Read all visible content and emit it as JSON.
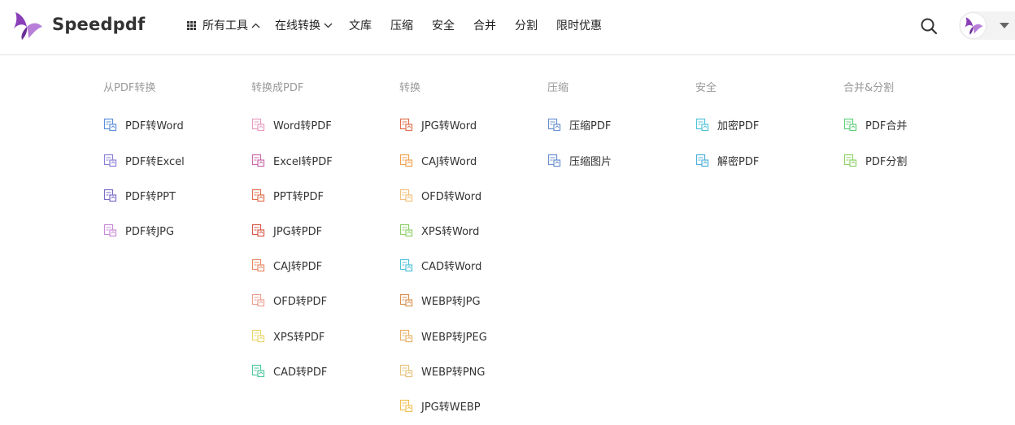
{
  "brand": {
    "name": "Speedpdf",
    "accent": "#9b4fc9"
  },
  "nav": [
    {
      "label": "所有工具",
      "icon": "grid-icon",
      "caret": "chevron-up-icon"
    },
    {
      "label": "在线转换",
      "caret": "chevron-down-icon"
    },
    {
      "label": "文库"
    },
    {
      "label": "压缩"
    },
    {
      "label": "安全"
    },
    {
      "label": "合并"
    },
    {
      "label": "分割"
    },
    {
      "label": "限时优惠"
    }
  ],
  "header_right": {
    "search_icon": "search-icon",
    "avatar_icon": "butterfly-avatar-icon",
    "menu_caret": "caret-down-icon"
  },
  "menu": [
    {
      "title": "从PDF转换",
      "items": [
        {
          "label": "PDF转Word",
          "color": "#5b8fd9"
        },
        {
          "label": "PDF转Excel",
          "color": "#8a7fd6"
        },
        {
          "label": "PDF转PPT",
          "color": "#7a6cc9"
        },
        {
          "label": "PDF转JPG",
          "color": "#c98bd8"
        }
      ]
    },
    {
      "title": "转换成PDF",
      "items": [
        {
          "label": "Word转PDF",
          "color": "#e79bc0"
        },
        {
          "label": "Excel转PDF",
          "color": "#c66aa8"
        },
        {
          "label": "PPT转PDF",
          "color": "#e0704f"
        },
        {
          "label": "JPG转PDF",
          "color": "#d85a4a"
        },
        {
          "label": "CAJ转PDF",
          "color": "#e88a66"
        },
        {
          "label": "OFD转PDF",
          "color": "#eda092"
        },
        {
          "label": "XPS转PDF",
          "color": "#e9d66a"
        },
        {
          "label": "CAD转PDF",
          "color": "#4fc9a0"
        }
      ]
    },
    {
      "title": "转换",
      "items": [
        {
          "label": "JPG转Word",
          "color": "#e0704f"
        },
        {
          "label": "CAJ转Word",
          "color": "#f0a24f"
        },
        {
          "label": "OFD转Word",
          "color": "#f2c07a"
        },
        {
          "label": "XPS转Word",
          "color": "#8ed06a"
        },
        {
          "label": "CAD转Word",
          "color": "#4fc3d9"
        },
        {
          "label": "WEBP转JPG",
          "color": "#d9924f"
        },
        {
          "label": "WEBP转JPEG",
          "color": "#e9b06a"
        },
        {
          "label": "WEBP转PNG",
          "color": "#e6c27a"
        },
        {
          "label": "JPG转WEBP",
          "color": "#f0c04f"
        }
      ]
    },
    {
      "title": "压缩",
      "items": [
        {
          "label": "压缩PDF",
          "color": "#6a8fcf"
        },
        {
          "label": "压缩图片",
          "color": "#6a8fcf"
        }
      ]
    },
    {
      "title": "安全",
      "items": [
        {
          "label": "加密PDF",
          "color": "#4fc3d9"
        },
        {
          "label": "解密PDF",
          "color": "#4fb0d9"
        }
      ]
    },
    {
      "title": "合并&分割",
      "items": [
        {
          "label": "PDF合并",
          "color": "#5fcf7a"
        },
        {
          "label": "PDF分割",
          "color": "#8fd06a"
        }
      ]
    }
  ]
}
